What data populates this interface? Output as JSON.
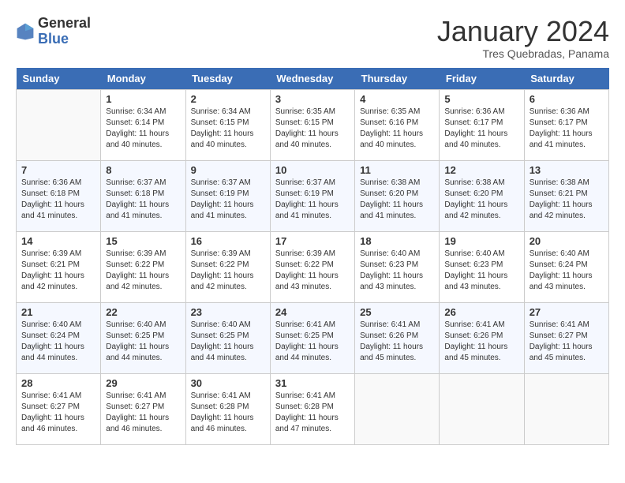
{
  "logo": {
    "text_general": "General",
    "text_blue": "Blue"
  },
  "header": {
    "title": "January 2024",
    "subtitle": "Tres Quebradas, Panama"
  },
  "weekdays": [
    "Sunday",
    "Monday",
    "Tuesday",
    "Wednesday",
    "Thursday",
    "Friday",
    "Saturday"
  ],
  "weeks": [
    [
      {
        "day": "",
        "sunrise": "",
        "sunset": "",
        "daylight": ""
      },
      {
        "day": "1",
        "sunrise": "Sunrise: 6:34 AM",
        "sunset": "Sunset: 6:14 PM",
        "daylight": "Daylight: 11 hours and 40 minutes."
      },
      {
        "day": "2",
        "sunrise": "Sunrise: 6:34 AM",
        "sunset": "Sunset: 6:15 PM",
        "daylight": "Daylight: 11 hours and 40 minutes."
      },
      {
        "day": "3",
        "sunrise": "Sunrise: 6:35 AM",
        "sunset": "Sunset: 6:15 PM",
        "daylight": "Daylight: 11 hours and 40 minutes."
      },
      {
        "day": "4",
        "sunrise": "Sunrise: 6:35 AM",
        "sunset": "Sunset: 6:16 PM",
        "daylight": "Daylight: 11 hours and 40 minutes."
      },
      {
        "day": "5",
        "sunrise": "Sunrise: 6:36 AM",
        "sunset": "Sunset: 6:17 PM",
        "daylight": "Daylight: 11 hours and 40 minutes."
      },
      {
        "day": "6",
        "sunrise": "Sunrise: 6:36 AM",
        "sunset": "Sunset: 6:17 PM",
        "daylight": "Daylight: 11 hours and 41 minutes."
      }
    ],
    [
      {
        "day": "7",
        "sunrise": "Sunrise: 6:36 AM",
        "sunset": "Sunset: 6:18 PM",
        "daylight": "Daylight: 11 hours and 41 minutes."
      },
      {
        "day": "8",
        "sunrise": "Sunrise: 6:37 AM",
        "sunset": "Sunset: 6:18 PM",
        "daylight": "Daylight: 11 hours and 41 minutes."
      },
      {
        "day": "9",
        "sunrise": "Sunrise: 6:37 AM",
        "sunset": "Sunset: 6:19 PM",
        "daylight": "Daylight: 11 hours and 41 minutes."
      },
      {
        "day": "10",
        "sunrise": "Sunrise: 6:37 AM",
        "sunset": "Sunset: 6:19 PM",
        "daylight": "Daylight: 11 hours and 41 minutes."
      },
      {
        "day": "11",
        "sunrise": "Sunrise: 6:38 AM",
        "sunset": "Sunset: 6:20 PM",
        "daylight": "Daylight: 11 hours and 41 minutes."
      },
      {
        "day": "12",
        "sunrise": "Sunrise: 6:38 AM",
        "sunset": "Sunset: 6:20 PM",
        "daylight": "Daylight: 11 hours and 42 minutes."
      },
      {
        "day": "13",
        "sunrise": "Sunrise: 6:38 AM",
        "sunset": "Sunset: 6:21 PM",
        "daylight": "Daylight: 11 hours and 42 minutes."
      }
    ],
    [
      {
        "day": "14",
        "sunrise": "Sunrise: 6:39 AM",
        "sunset": "Sunset: 6:21 PM",
        "daylight": "Daylight: 11 hours and 42 minutes."
      },
      {
        "day": "15",
        "sunrise": "Sunrise: 6:39 AM",
        "sunset": "Sunset: 6:22 PM",
        "daylight": "Daylight: 11 hours and 42 minutes."
      },
      {
        "day": "16",
        "sunrise": "Sunrise: 6:39 AM",
        "sunset": "Sunset: 6:22 PM",
        "daylight": "Daylight: 11 hours and 42 minutes."
      },
      {
        "day": "17",
        "sunrise": "Sunrise: 6:39 AM",
        "sunset": "Sunset: 6:22 PM",
        "daylight": "Daylight: 11 hours and 43 minutes."
      },
      {
        "day": "18",
        "sunrise": "Sunrise: 6:40 AM",
        "sunset": "Sunset: 6:23 PM",
        "daylight": "Daylight: 11 hours and 43 minutes."
      },
      {
        "day": "19",
        "sunrise": "Sunrise: 6:40 AM",
        "sunset": "Sunset: 6:23 PM",
        "daylight": "Daylight: 11 hours and 43 minutes."
      },
      {
        "day": "20",
        "sunrise": "Sunrise: 6:40 AM",
        "sunset": "Sunset: 6:24 PM",
        "daylight": "Daylight: 11 hours and 43 minutes."
      }
    ],
    [
      {
        "day": "21",
        "sunrise": "Sunrise: 6:40 AM",
        "sunset": "Sunset: 6:24 PM",
        "daylight": "Daylight: 11 hours and 44 minutes."
      },
      {
        "day": "22",
        "sunrise": "Sunrise: 6:40 AM",
        "sunset": "Sunset: 6:25 PM",
        "daylight": "Daylight: 11 hours and 44 minutes."
      },
      {
        "day": "23",
        "sunrise": "Sunrise: 6:40 AM",
        "sunset": "Sunset: 6:25 PM",
        "daylight": "Daylight: 11 hours and 44 minutes."
      },
      {
        "day": "24",
        "sunrise": "Sunrise: 6:41 AM",
        "sunset": "Sunset: 6:25 PM",
        "daylight": "Daylight: 11 hours and 44 minutes."
      },
      {
        "day": "25",
        "sunrise": "Sunrise: 6:41 AM",
        "sunset": "Sunset: 6:26 PM",
        "daylight": "Daylight: 11 hours and 45 minutes."
      },
      {
        "day": "26",
        "sunrise": "Sunrise: 6:41 AM",
        "sunset": "Sunset: 6:26 PM",
        "daylight": "Daylight: 11 hours and 45 minutes."
      },
      {
        "day": "27",
        "sunrise": "Sunrise: 6:41 AM",
        "sunset": "Sunset: 6:27 PM",
        "daylight": "Daylight: 11 hours and 45 minutes."
      }
    ],
    [
      {
        "day": "28",
        "sunrise": "Sunrise: 6:41 AM",
        "sunset": "Sunset: 6:27 PM",
        "daylight": "Daylight: 11 hours and 46 minutes."
      },
      {
        "day": "29",
        "sunrise": "Sunrise: 6:41 AM",
        "sunset": "Sunset: 6:27 PM",
        "daylight": "Daylight: 11 hours and 46 minutes."
      },
      {
        "day": "30",
        "sunrise": "Sunrise: 6:41 AM",
        "sunset": "Sunset: 6:28 PM",
        "daylight": "Daylight: 11 hours and 46 minutes."
      },
      {
        "day": "31",
        "sunrise": "Sunrise: 6:41 AM",
        "sunset": "Sunset: 6:28 PM",
        "daylight": "Daylight: 11 hours and 47 minutes."
      },
      {
        "day": "",
        "sunrise": "",
        "sunset": "",
        "daylight": ""
      },
      {
        "day": "",
        "sunrise": "",
        "sunset": "",
        "daylight": ""
      },
      {
        "day": "",
        "sunrise": "",
        "sunset": "",
        "daylight": ""
      }
    ]
  ]
}
